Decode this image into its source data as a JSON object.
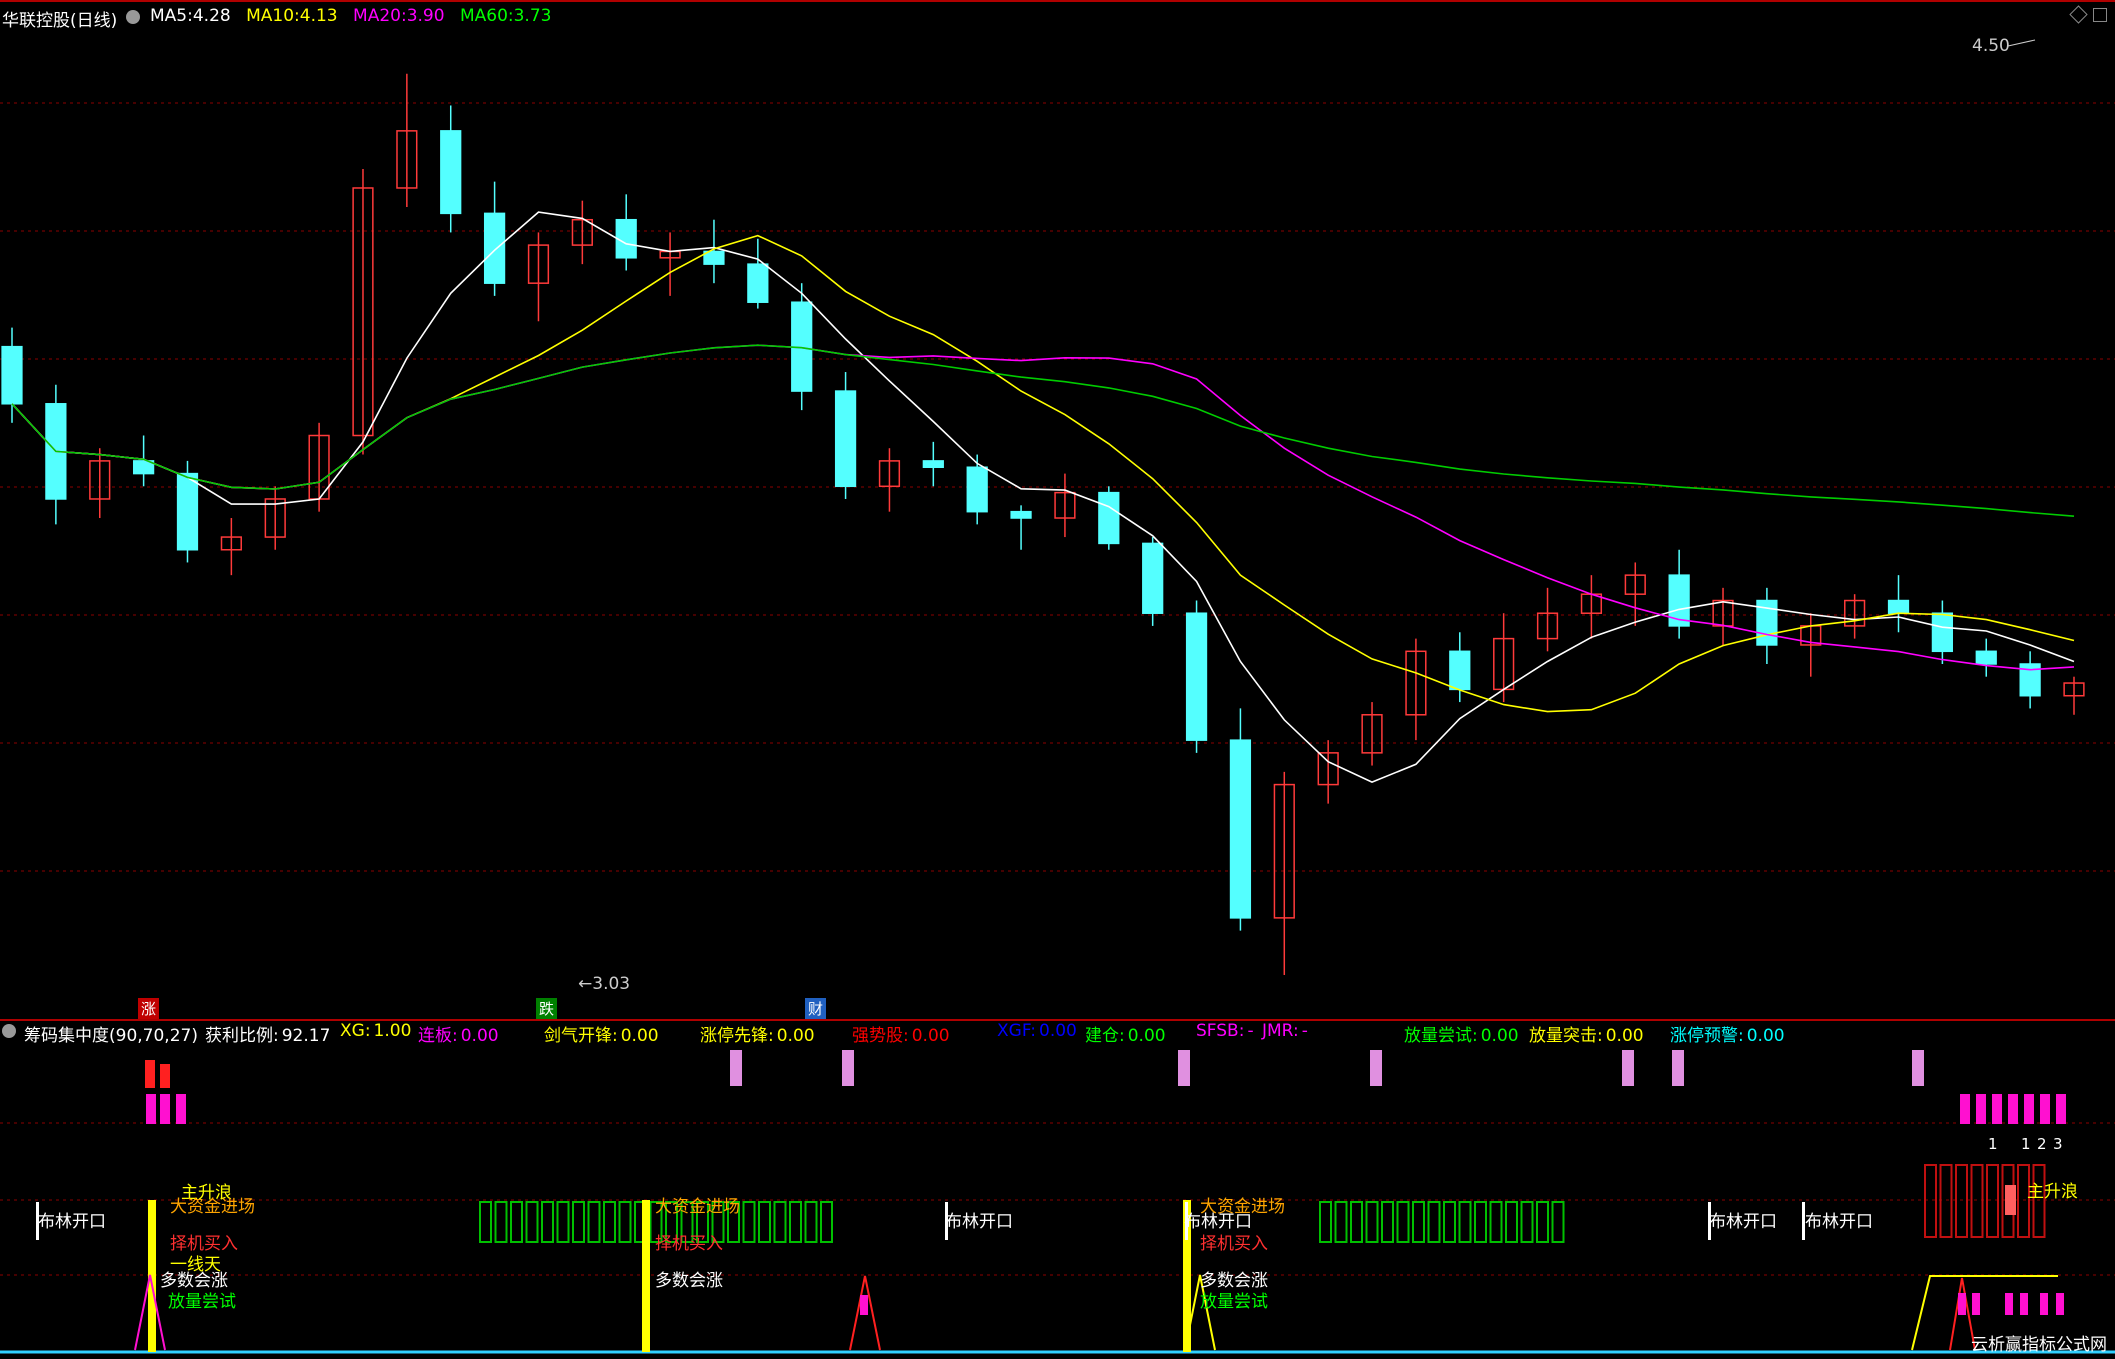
{
  "title": "华联控股(日线)",
  "ma_legend": [
    {
      "label": "MA5:",
      "value": "4.28",
      "color": "#ffffff"
    },
    {
      "label": "MA10:",
      "value": "4.13",
      "color": "#ffff00"
    },
    {
      "label": "MA20:",
      "value": "3.90",
      "color": "#ff00ff"
    },
    {
      "label": "MA60:",
      "value": "3.73",
      "color": "#00ff00"
    }
  ],
  "price_marks": {
    "high": "4.50",
    "low": "3.03"
  },
  "event_marks": [
    {
      "text": "涨",
      "bg": "#c00000"
    },
    {
      "text": "跌",
      "bg": "#008000"
    },
    {
      "text": "财",
      "bg": "#2060c0"
    }
  ],
  "indicator": {
    "name": "筹码集中度",
    "params": "(90,70,27)",
    "items": [
      {
        "label": "获利比例:",
        "value": "92.17",
        "color": "#ffffff"
      },
      {
        "label": "XG:",
        "value": "1.00",
        "color": "#ffff00"
      },
      {
        "label": "连板:",
        "value": "0.00",
        "color": "#ff00ff"
      },
      {
        "label": "剑气开锋:",
        "value": "0.00",
        "color": "#ffff00"
      },
      {
        "label": "涨停先锋:",
        "value": "0.00",
        "color": "#ffff00"
      },
      {
        "label": "强势股:",
        "value": "0.00",
        "color": "#ff0000"
      },
      {
        "label": "XGF:",
        "value": "0.00",
        "color": "#0000ff"
      },
      {
        "label": "建仓:",
        "value": "0.00",
        "color": "#00ff00"
      },
      {
        "label": "SFSB:",
        "value": "-",
        "color": "#ff00ff"
      },
      {
        "label": "JMR:",
        "value": "-",
        "color": "#ff00ff"
      },
      {
        "label": "放量尝试:",
        "value": "0.00",
        "color": "#00ff00"
      },
      {
        "label": "放量突击:",
        "value": "0.00",
        "color": "#ffff00"
      },
      {
        "label": "涨停预警:",
        "value": "0.00",
        "color": "#00ffff"
      }
    ]
  },
  "signals": {
    "zhu_sheng_lang": "主升浪",
    "da_zi_jin": "大资金进场",
    "ze_ji_mai_ru": "择机买入",
    "yi_xian_tian": "一线天",
    "duo_shu_hui_zhang": "多数会涨",
    "fang_liang_chang_shi": "放量尝试",
    "bu_lin_kai_kou": "布林开口",
    "counter": [
      "1",
      "1",
      "2",
      "3"
    ]
  },
  "watermark": "云析赢指标公式网",
  "colors": {
    "up": "#ff3a3a",
    "down": "#54ffff",
    "ma5": "#ffffff",
    "ma10": "#ffff00",
    "ma20": "#ff00ff",
    "ma60": "#00cc00",
    "grid": "#8b0000"
  },
  "chart_data": {
    "type": "candlestick",
    "price_range": [
      3.03,
      4.5
    ],
    "ohlc": [
      [
        4.02,
        4.05,
        3.9,
        3.93
      ],
      [
        3.93,
        3.96,
        3.74,
        3.78
      ],
      [
        3.78,
        3.86,
        3.75,
        3.84
      ],
      [
        3.84,
        3.88,
        3.8,
        3.82
      ],
      [
        3.82,
        3.84,
        3.68,
        3.7
      ],
      [
        3.7,
        3.75,
        3.66,
        3.72
      ],
      [
        3.72,
        3.8,
        3.7,
        3.78
      ],
      [
        3.78,
        3.9,
        3.76,
        3.88
      ],
      [
        3.88,
        4.3,
        3.85,
        4.27
      ],
      [
        4.27,
        4.45,
        4.24,
        4.36
      ],
      [
        4.36,
        4.4,
        4.2,
        4.23
      ],
      [
        4.23,
        4.28,
        4.1,
        4.12
      ],
      [
        4.12,
        4.2,
        4.06,
        4.18
      ],
      [
        4.18,
        4.25,
        4.15,
        4.22
      ],
      [
        4.22,
        4.26,
        4.14,
        4.16
      ],
      [
        4.16,
        4.2,
        4.1,
        4.17
      ],
      [
        4.17,
        4.22,
        4.12,
        4.15
      ],
      [
        4.15,
        4.19,
        4.08,
        4.09
      ],
      [
        4.09,
        4.12,
        3.92,
        3.95
      ],
      [
        3.95,
        3.98,
        3.78,
        3.8
      ],
      [
        3.8,
        3.86,
        3.76,
        3.84
      ],
      [
        3.84,
        3.87,
        3.8,
        3.83
      ],
      [
        3.83,
        3.85,
        3.74,
        3.76
      ],
      [
        3.76,
        3.77,
        3.7,
        3.75
      ],
      [
        3.75,
        3.82,
        3.72,
        3.79
      ],
      [
        3.79,
        3.8,
        3.7,
        3.71
      ],
      [
        3.71,
        3.72,
        3.58,
        3.6
      ],
      [
        3.6,
        3.62,
        3.38,
        3.4
      ],
      [
        3.4,
        3.45,
        3.1,
        3.12
      ],
      [
        3.12,
        3.35,
        3.03,
        3.33
      ],
      [
        3.33,
        3.4,
        3.3,
        3.38
      ],
      [
        3.38,
        3.46,
        3.36,
        3.44
      ],
      [
        3.44,
        3.56,
        3.4,
        3.54
      ],
      [
        3.54,
        3.57,
        3.46,
        3.48
      ],
      [
        3.48,
        3.6,
        3.46,
        3.56
      ],
      [
        3.56,
        3.64,
        3.54,
        3.6
      ],
      [
        3.6,
        3.66,
        3.56,
        3.63
      ],
      [
        3.63,
        3.68,
        3.58,
        3.66
      ],
      [
        3.66,
        3.7,
        3.56,
        3.58
      ],
      [
        3.58,
        3.64,
        3.55,
        3.62
      ],
      [
        3.62,
        3.64,
        3.52,
        3.55
      ],
      [
        3.55,
        3.6,
        3.5,
        3.58
      ],
      [
        3.58,
        3.63,
        3.56,
        3.62
      ],
      [
        3.62,
        3.66,
        3.57,
        3.6
      ],
      [
        3.6,
        3.62,
        3.52,
        3.54
      ],
      [
        3.54,
        3.56,
        3.5,
        3.52
      ],
      [
        3.52,
        3.54,
        3.45,
        3.47
      ],
      [
        3.47,
        3.5,
        3.44,
        3.49
      ]
    ]
  }
}
